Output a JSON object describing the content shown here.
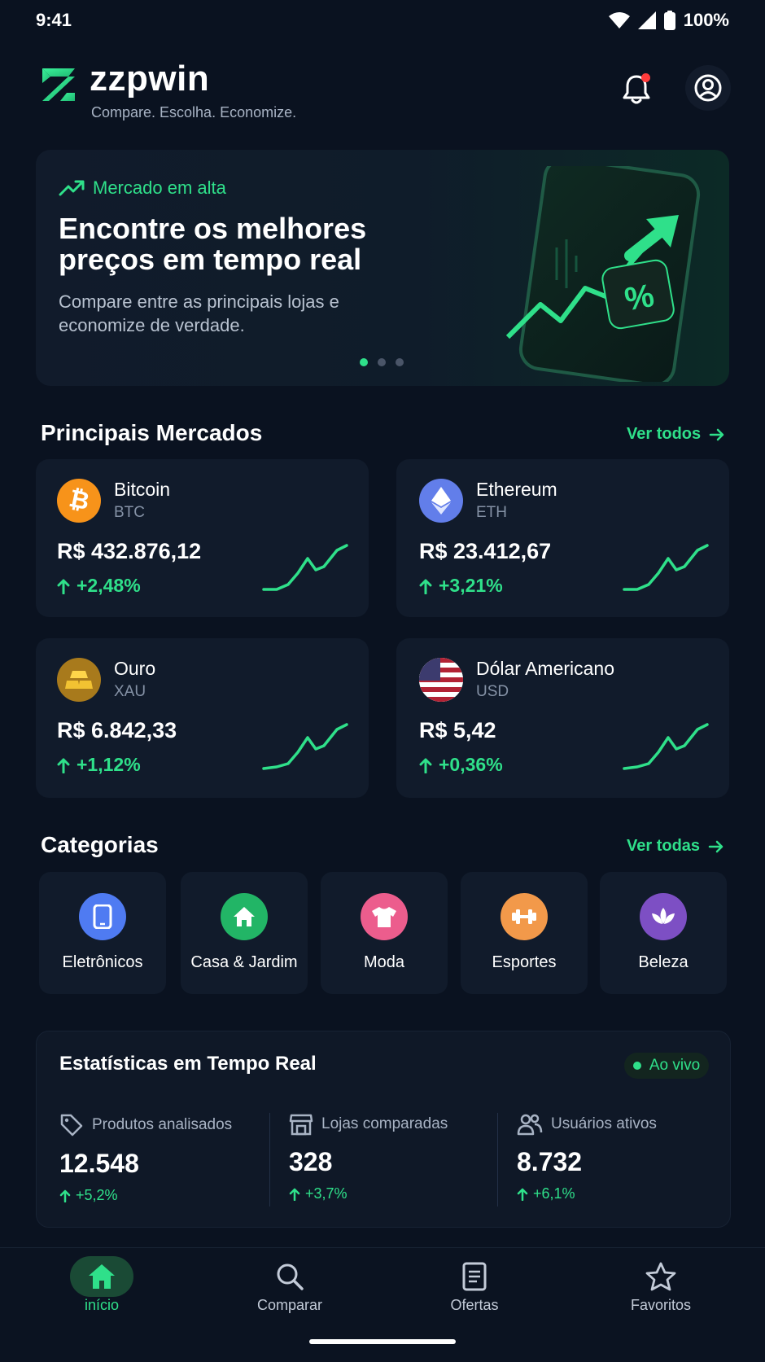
{
  "status": {
    "time": "9:41",
    "battery": "100%"
  },
  "header": {
    "brand": "zzpwin",
    "tagline": "Compare. Escolha. Economize."
  },
  "hero": {
    "tag": "Mercado em alta",
    "title": "Encontre os melhores preços em tempo real",
    "subtitle": "Compare entre as principais lojas e economize de verdade.",
    "dots": 3,
    "active_dot": 0
  },
  "markets": {
    "title": "Principais Mercados",
    "see_all": "Ver todos",
    "items": [
      {
        "name": "Bitcoin",
        "code": "BTC",
        "price": "R$ 432.876,12",
        "change": "+2,48%",
        "icon": "bitcoin-icon",
        "color": "#f7931a"
      },
      {
        "name": "Ethereum",
        "code": "ETH",
        "price": "R$ 23.412,67",
        "change": "+3,21%",
        "icon": "ethereum-icon",
        "color": "#627eea"
      },
      {
        "name": "Ouro",
        "code": "XAU",
        "price": "R$ 6.842,33",
        "change": "+1,12%",
        "icon": "gold-bars-icon",
        "color": "#b8860b"
      },
      {
        "name": "Dólar Americano",
        "code": "USD",
        "price": "R$ 5,42",
        "change": "+0,36%",
        "icon": "us-flag-icon",
        "color": "#b22234"
      }
    ]
  },
  "categories": {
    "title": "Categorias",
    "see_all": "Ver todas",
    "items": [
      {
        "label": "Eletrônicos",
        "icon": "smartphone-icon",
        "color": "#4f7bf2"
      },
      {
        "label": "Casa & Jardim",
        "icon": "home-icon",
        "color": "#22b566"
      },
      {
        "label": "Moda",
        "icon": "tshirt-icon",
        "color": "#ec5d8d"
      },
      {
        "label": "Esportes",
        "icon": "dumbbell-icon",
        "color": "#f2994a"
      },
      {
        "label": "Beleza",
        "icon": "lotus-icon",
        "color": "#7d4fc4"
      }
    ]
  },
  "stats": {
    "title": "Estatísticas em Tempo Real",
    "live": "Ao vivo",
    "items": [
      {
        "label": "Produtos analisados",
        "value": "12.548",
        "change": "+5,2%",
        "icon": "tag-icon"
      },
      {
        "label": "Lojas comparadas",
        "value": "328",
        "change": "+3,7%",
        "icon": "store-icon"
      },
      {
        "label": "Usuários ativos",
        "value": "8.732",
        "change": "+6,1%",
        "icon": "users-icon"
      }
    ]
  },
  "nav": {
    "items": [
      {
        "label": "início",
        "icon": "home-icon",
        "active": true
      },
      {
        "label": "Comparar",
        "icon": "search-icon",
        "active": false
      },
      {
        "label": "Ofertas",
        "icon": "document-icon",
        "active": false
      },
      {
        "label": "Favoritos",
        "icon": "star-icon",
        "active": false
      }
    ]
  },
  "colors": {
    "accent": "#2fe08a",
    "background": "#0a1220",
    "card": "#111b2b"
  }
}
